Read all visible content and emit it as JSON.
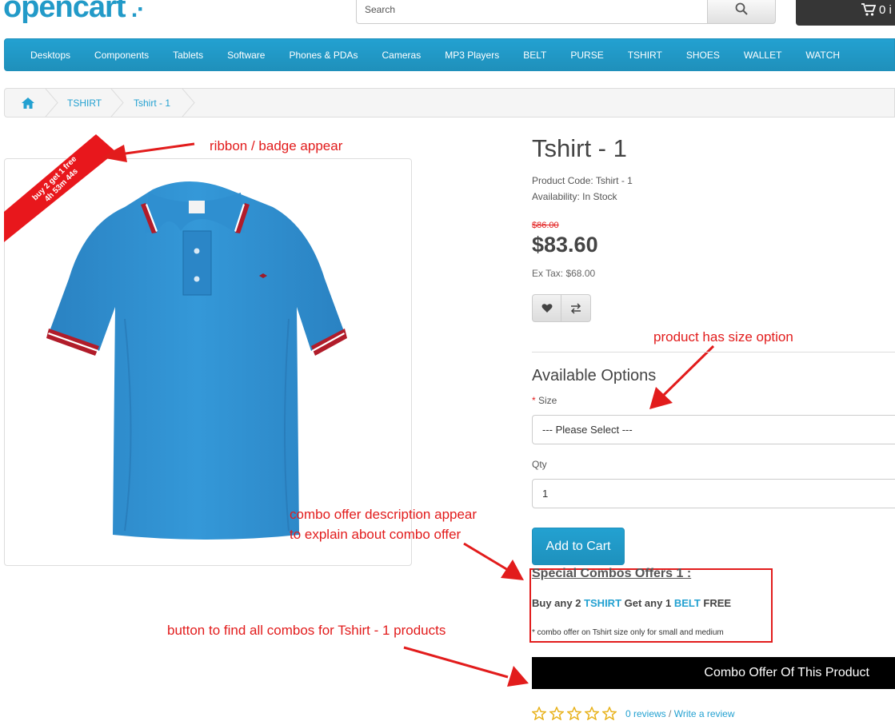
{
  "header": {
    "logo_text": "opencart",
    "search_placeholder": "Search",
    "cart_label": "0 i"
  },
  "nav": {
    "items": [
      "Desktops",
      "Components",
      "Tablets",
      "Software",
      "Phones & PDAs",
      "Cameras",
      "MP3 Players",
      "BELT",
      "PURSE",
      "TSHIRT",
      "SHOES",
      "WALLET",
      "WATCH"
    ]
  },
  "breadcrumb": {
    "items": [
      "TSHIRT",
      "Tshirt - 1"
    ]
  },
  "ribbon": {
    "line1": "buy 2 get 1 free",
    "line2": "4h 53m 44s"
  },
  "annotations": {
    "ribbon": "ribbon / badge appear",
    "size_option": "product has size option",
    "combo_desc_1": "combo offer description appear",
    "combo_desc_2": "to explain about combo offer",
    "combo_button": "button to find all combos for Tshirt - 1 products"
  },
  "product": {
    "title": "Tshirt - 1",
    "code": "Product Code: Tshirt - 1",
    "availability": "Availability: In Stock",
    "old_price": "$86.00",
    "price": "$83.60",
    "ex_tax": "Ex Tax: $68.00"
  },
  "options": {
    "heading": "Available Options",
    "required_mark": "*",
    "size_label": "Size",
    "size_value": "--- Please Select ---",
    "qty_label": "Qty",
    "qty_value": "1",
    "add_to_cart": "Add to Cart"
  },
  "combo": {
    "heading": "Special Combos Offers 1 :",
    "buy_any": "Buy any",
    "buy_qty": "2",
    "buy_item": "TSHIRT",
    "get_any": "Get any",
    "get_qty": "1",
    "get_item": "BELT",
    "free": "FREE",
    "note": "* combo offer on Tshirt size only for small and medium",
    "button": "Combo Offer Of This Product"
  },
  "reviews": {
    "rating": 0,
    "count_label": "0 reviews",
    "separator": "/",
    "write_label": "Write a review"
  },
  "colors": {
    "brand_blue": "#23a1d1",
    "annotation_red": "#e21c1c",
    "shirt_blue": "#2f8fd0"
  }
}
